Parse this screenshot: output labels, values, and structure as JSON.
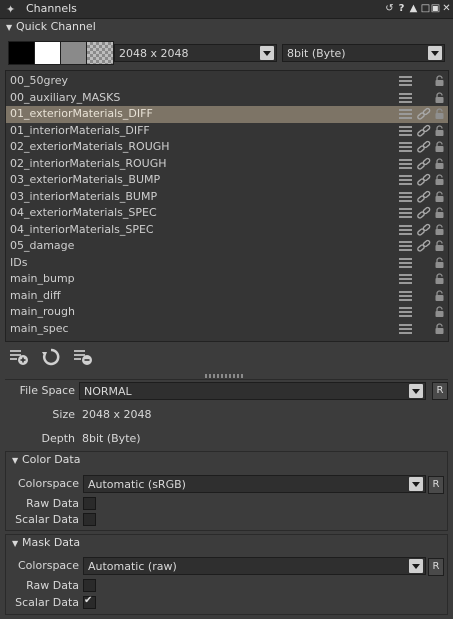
{
  "window": {
    "title": "Channels",
    "title_icon": "channels-icon",
    "controls": [
      "restore-icon",
      "help-icon",
      "pin-icon",
      "minimize-icon",
      "maximize-icon",
      "close-icon"
    ]
  },
  "quick_channel": {
    "header": "Quick Channel",
    "swatches": [
      "#000000",
      "#ffffff",
      "#808080",
      "checker"
    ],
    "size_value": "2048 x 2048",
    "depth_value": "8bit  (Byte)"
  },
  "channels": [
    {
      "label": "00_50grey",
      "linked": false
    },
    {
      "label": "00_auxiliary_MASKS",
      "linked": false
    },
    {
      "label": "01_exteriorMaterials_DIFF",
      "linked": true,
      "selected": true
    },
    {
      "label": "01_interiorMaterials_DIFF",
      "linked": true
    },
    {
      "label": "02_exteriorMaterials_ROUGH",
      "linked": true
    },
    {
      "label": "02_interiorMaterials_ROUGH",
      "linked": true
    },
    {
      "label": "03_exteriorMaterials_BUMP",
      "linked": true
    },
    {
      "label": "03_interiorMaterials_BUMP",
      "linked": true
    },
    {
      "label": "04_exteriorMaterials_SPEC",
      "linked": true
    },
    {
      "label": "04_interiorMaterials_SPEC",
      "linked": true
    },
    {
      "label": "05_damage",
      "linked": true
    },
    {
      "label": "IDs",
      "linked": false
    },
    {
      "label": "main_bump",
      "linked": false
    },
    {
      "label": "main_diff",
      "linked": false
    },
    {
      "label": "main_rough",
      "linked": false
    },
    {
      "label": "main_spec",
      "linked": false
    }
  ],
  "toolbar": {
    "icons": [
      "add-channel-icon",
      "refresh-channel-icon",
      "remove-channel-icon"
    ]
  },
  "properties": {
    "file_space_label": "File Space",
    "file_space_value": "NORMAL",
    "size_label": "Size",
    "size_value": "2048 x 2048",
    "depth_label": "Depth",
    "depth_value": "8bit  (Byte)",
    "r_label": "R"
  },
  "color_data": {
    "header": "Color Data",
    "colorspace_label": "Colorspace",
    "colorspace_value": "Automatic (sRGB)",
    "raw_label": "Raw Data",
    "raw_checked": false,
    "scalar_label": "Scalar Data",
    "scalar_checked": false
  },
  "mask_data": {
    "header": "Mask Data",
    "colorspace_label": "Colorspace",
    "colorspace_value": "Automatic (raw)",
    "raw_label": "Raw Data",
    "raw_checked": false,
    "scalar_label": "Scalar Data",
    "scalar_checked": true
  },
  "colors": {
    "selection": "#7d7466",
    "panel": "#3c3c3c",
    "list_bg": "#353535"
  }
}
